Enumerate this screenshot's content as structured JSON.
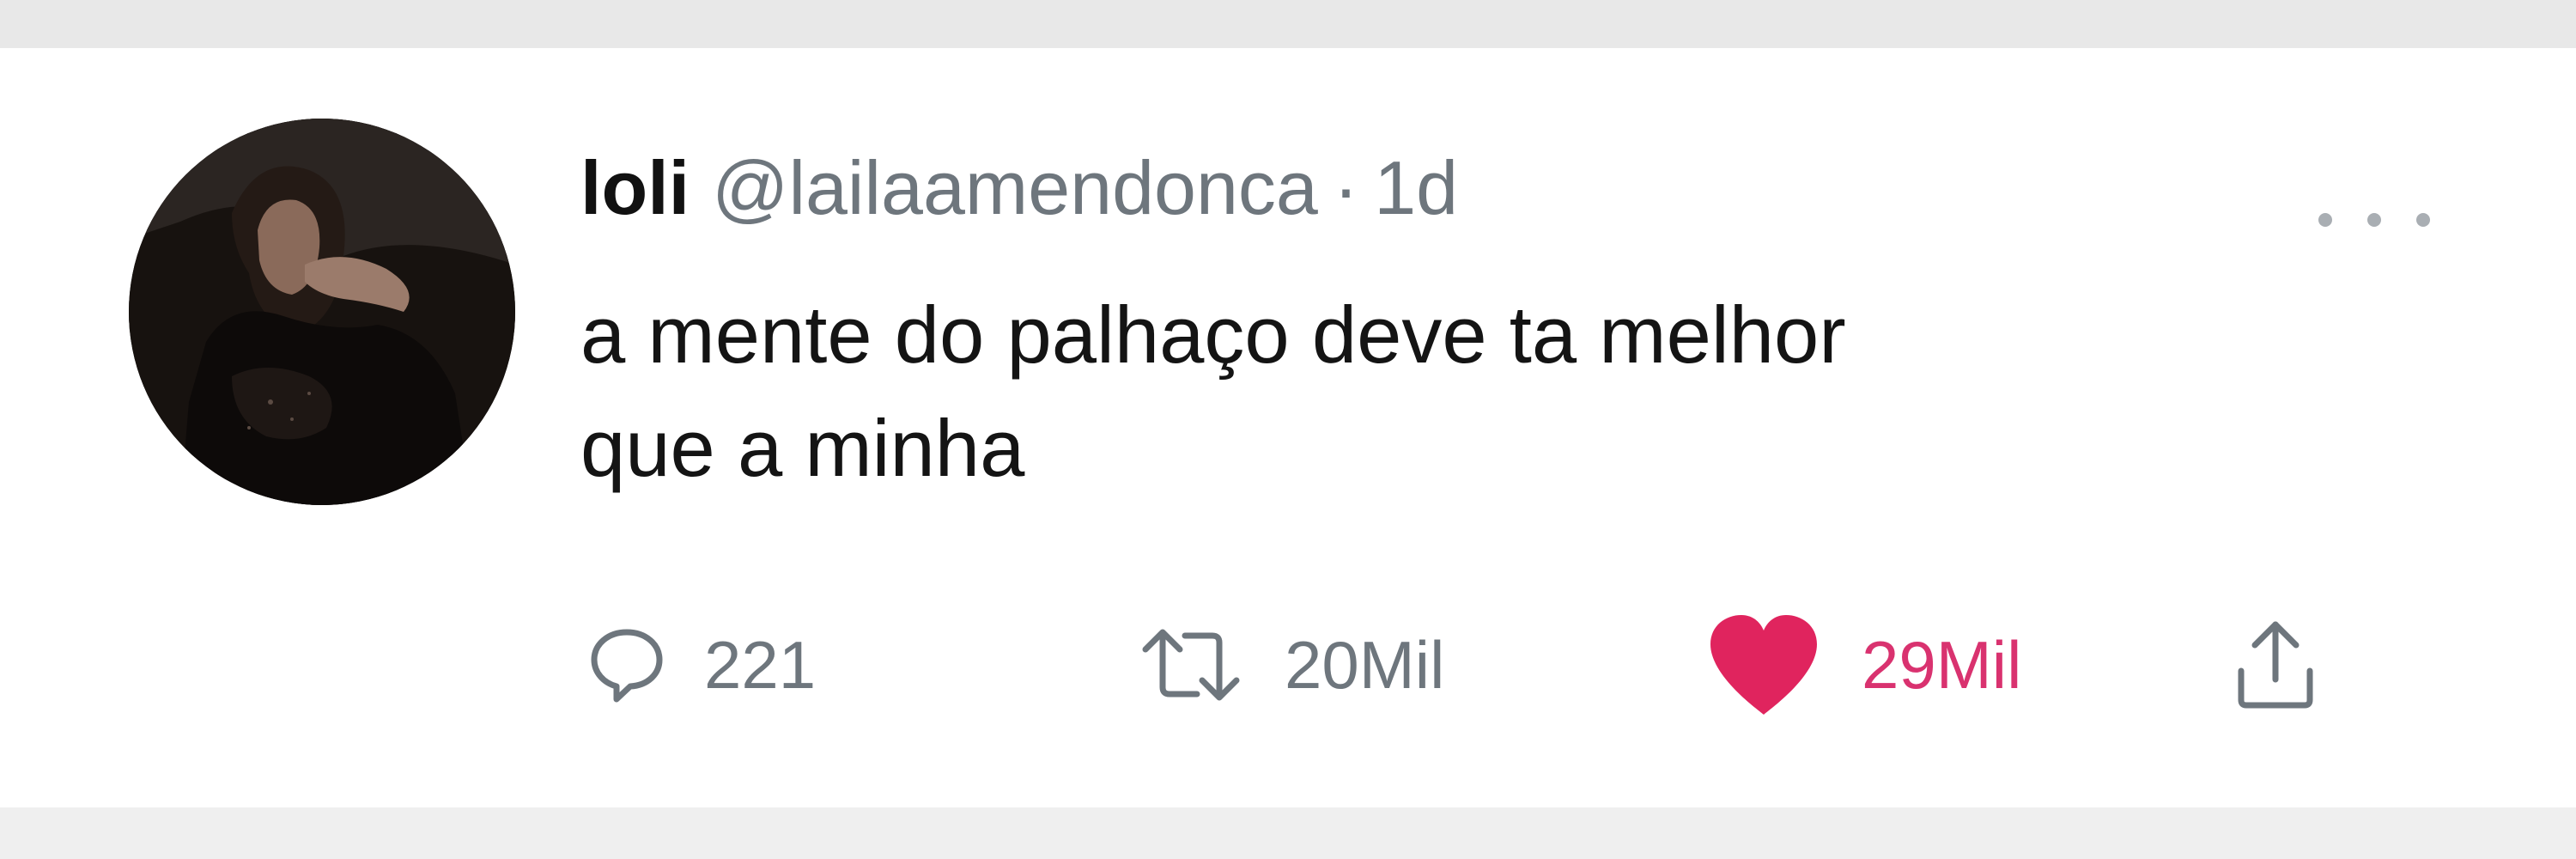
{
  "tweet": {
    "author": {
      "display_name": "loli",
      "handle": "@lailaamendonca",
      "separator": "·",
      "time": "1d"
    },
    "text_lines": [
      "a mente do palhaço deve ta melhor",
      "que a minha"
    ],
    "actions": {
      "reply": {
        "icon": "reply-icon",
        "count": "221"
      },
      "retweet": {
        "icon": "retweet-icon",
        "count": "20Mil"
      },
      "like": {
        "icon": "heart-icon",
        "count": "29Mil",
        "active": true,
        "color": "#e0245e"
      },
      "share": {
        "icon": "share-icon"
      }
    },
    "more_icon": "more-options-icon"
  },
  "colors": {
    "text": "#141414",
    "muted": "#6e767d",
    "like": "#e0245e",
    "background": "#ffffff"
  }
}
